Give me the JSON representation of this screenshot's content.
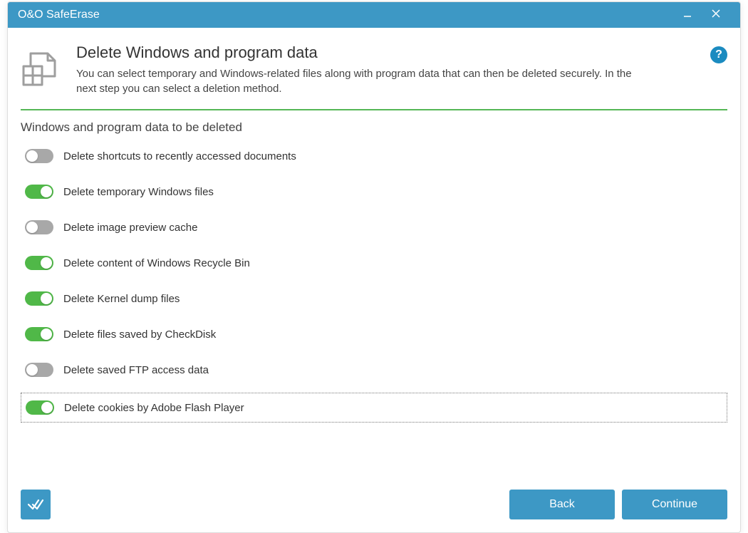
{
  "titlebar": {
    "title": "O&O SafeErase"
  },
  "header": {
    "title": "Delete Windows and program data",
    "description": "You can select temporary and Windows-related files along with program data that can then be deleted securely. In the next step you can select a deletion method."
  },
  "section_title": "Windows and program data to be deleted",
  "options": [
    {
      "label": "Delete shortcuts to recently accessed documents",
      "on": false,
      "focused": false
    },
    {
      "label": "Delete temporary Windows files",
      "on": true,
      "focused": false
    },
    {
      "label": "Delete image preview cache",
      "on": false,
      "focused": false
    },
    {
      "label": "Delete content of Windows Recycle Bin",
      "on": true,
      "focused": false
    },
    {
      "label": "Delete Kernel dump files",
      "on": true,
      "focused": false
    },
    {
      "label": "Delete files saved by CheckDisk",
      "on": true,
      "focused": false
    },
    {
      "label": "Delete saved FTP access data",
      "on": false,
      "focused": false
    },
    {
      "label": "Delete cookies by Adobe Flash Player",
      "on": true,
      "focused": true
    }
  ],
  "footer": {
    "back": "Back",
    "continue": "Continue"
  }
}
